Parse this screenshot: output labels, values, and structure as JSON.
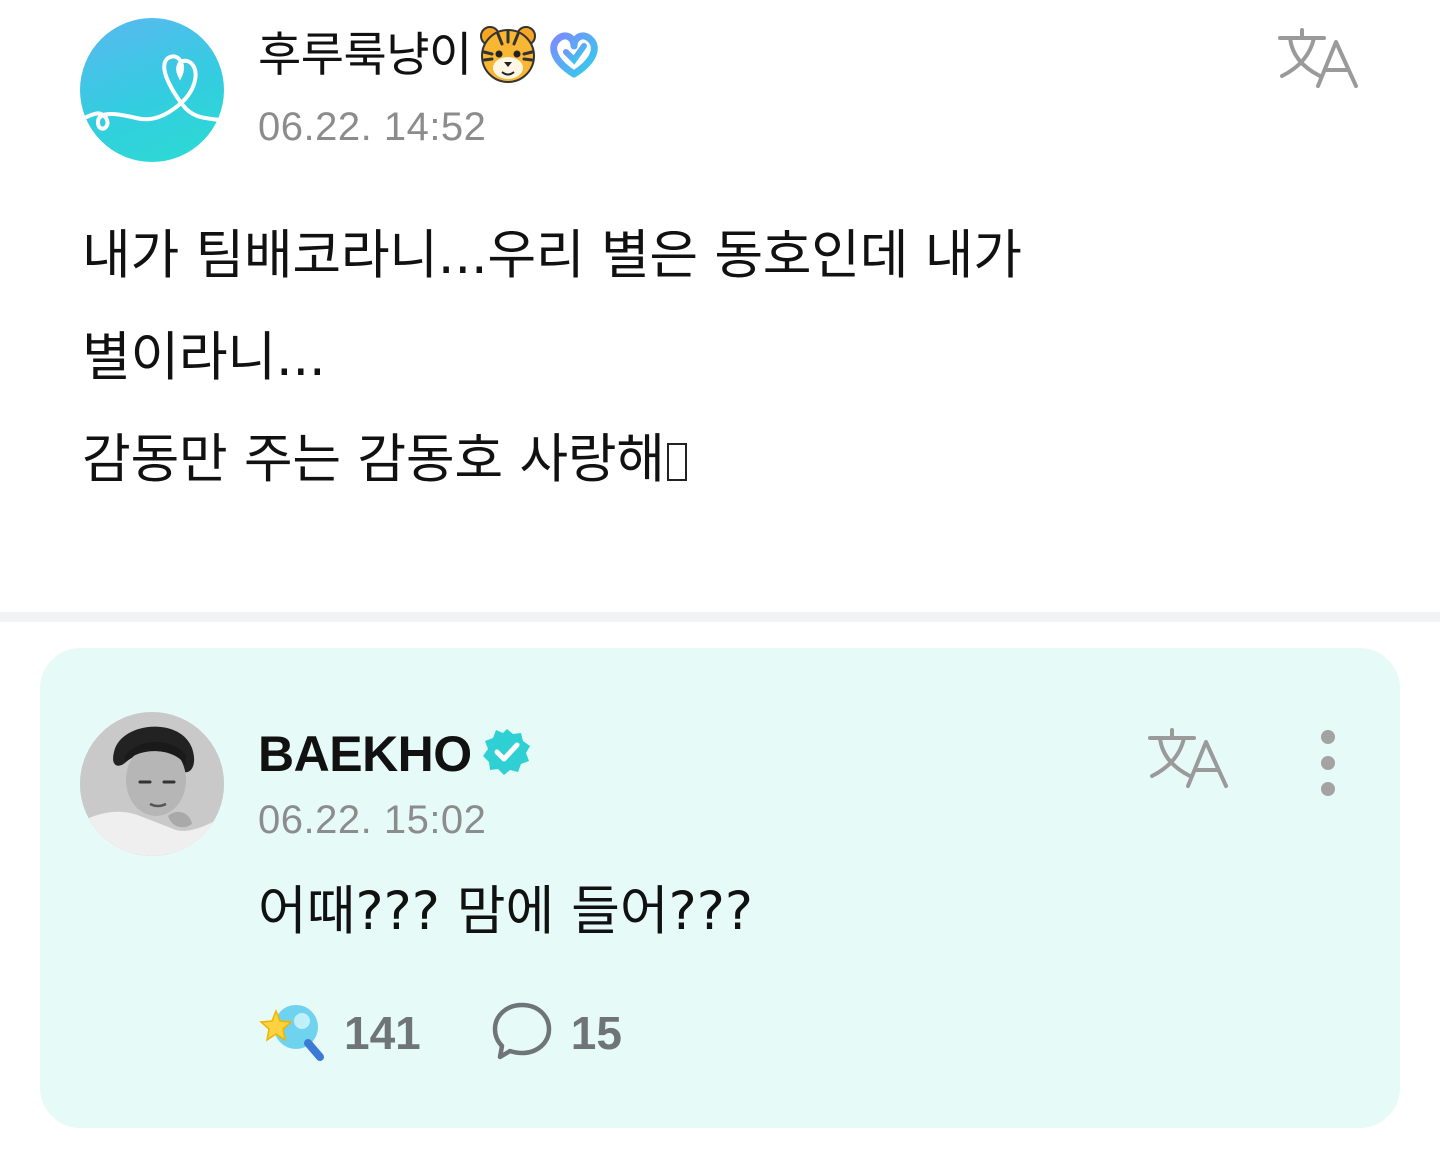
{
  "post": {
    "author_name": "후루룩냥이",
    "timestamp": "06.22. 14:52",
    "body_lines": [
      "내가 팀배코라니...우리 별은 동호인데 내가",
      "별이라니...",
      "감동만 주는 감동호 사랑해"
    ],
    "icons": {
      "avatar": "heart-line-avatar",
      "name_badges": [
        "tiger-face-icon",
        "membership-heart-badge-icon"
      ],
      "translate": "translate-icon"
    }
  },
  "reply": {
    "author_name": "BAEKHO",
    "verified": true,
    "timestamp": "06.22. 15:02",
    "text": "어때??? 맘에 들어???",
    "likes": "141",
    "comments": "15",
    "icons": {
      "verified": "verified-badge-icon",
      "translate": "translate-icon",
      "more": "more-vertical-icon",
      "like": "lightstick-star-icon",
      "comment": "speech-bubble-icon"
    }
  },
  "colors": {
    "card_background": "#e6fbf8",
    "accent_teal": "#2fd0d4",
    "muted_text": "#8c8c8c",
    "stat_text": "#6f7479"
  }
}
